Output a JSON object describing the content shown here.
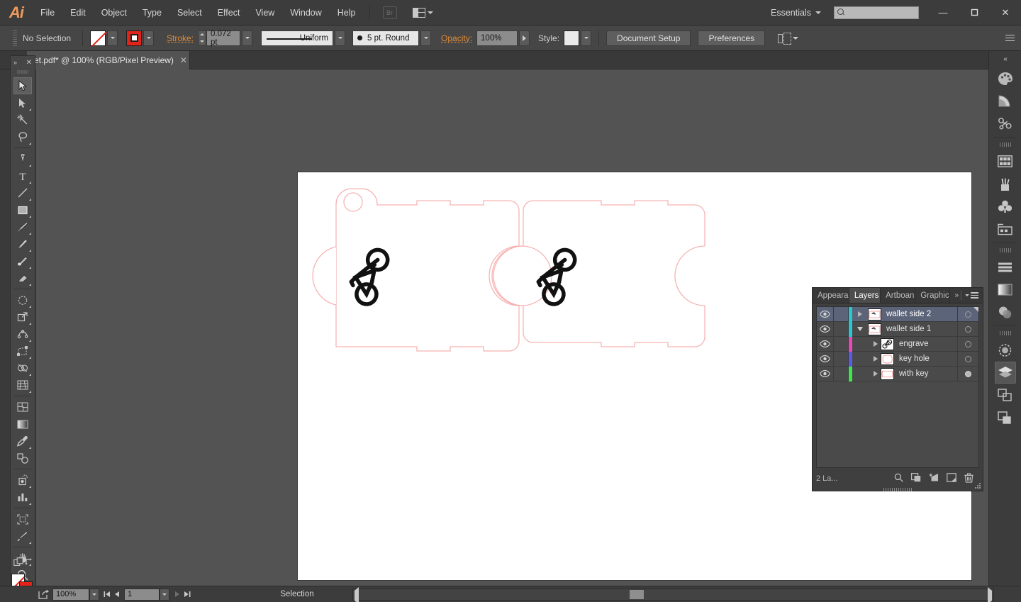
{
  "app": {
    "name": "Adobe Illustrator",
    "logo_text": "Ai"
  },
  "menubar": {
    "items": [
      "File",
      "Edit",
      "Object",
      "Type",
      "Select",
      "Effect",
      "View",
      "Window",
      "Help"
    ],
    "bridge_label": "Br",
    "workspace": "Essentials",
    "search_value": "",
    "window_buttons": {
      "minimize": "—",
      "maximize": "❐",
      "close": "✕"
    }
  },
  "controlbar": {
    "selection_state": "No Selection",
    "fill_label": "Fill",
    "stroke_swatch_label": "Stroke color",
    "stroke_label": "Stroke:",
    "stroke_weight": "0.072 pt",
    "stroke_profile": "Uniform",
    "brush_definition": "5 pt. Round",
    "opacity_label": "Opacity:",
    "opacity_value": "100%",
    "style_label": "Style:",
    "document_setup": "Document Setup",
    "preferences": "Preferences",
    "align_label": "Align to selection"
  },
  "document_tab": {
    "title": "et.pdf* @ 100% (RGB/Pixel Preview)",
    "close": "✕"
  },
  "toolbar": {
    "collapse": "»",
    "close": "✕",
    "tools": [
      {
        "name": "selection-tool",
        "selected": true
      },
      {
        "name": "direct-selection-tool",
        "selected": false
      },
      {
        "name": "magic-wand-tool",
        "selected": false
      },
      {
        "name": "lasso-tool",
        "selected": false
      },
      {
        "name": "pen-tool",
        "selected": false
      },
      {
        "name": "type-tool",
        "selected": false
      },
      {
        "name": "line-segment-tool",
        "selected": false
      },
      {
        "name": "rectangle-tool",
        "selected": false
      },
      {
        "name": "paintbrush-tool",
        "selected": false
      },
      {
        "name": "pencil-tool",
        "selected": false
      },
      {
        "name": "blob-brush-tool",
        "selected": false
      },
      {
        "name": "eraser-tool",
        "selected": false
      },
      {
        "name": "rotate-tool",
        "selected": false
      },
      {
        "name": "scale-tool",
        "selected": false
      },
      {
        "name": "width-tool",
        "selected": false
      },
      {
        "name": "free-transform-tool",
        "selected": false
      },
      {
        "name": "shape-builder-tool",
        "selected": false
      },
      {
        "name": "perspective-grid-tool",
        "selected": false
      },
      {
        "name": "mesh-tool",
        "selected": false
      },
      {
        "name": "gradient-tool",
        "selected": false
      },
      {
        "name": "eyedropper-tool",
        "selected": false
      },
      {
        "name": "blend-tool",
        "selected": false
      },
      {
        "name": "symbol-sprayer-tool",
        "selected": false
      },
      {
        "name": "column-graph-tool",
        "selected": false
      },
      {
        "name": "artboard-tool",
        "selected": false
      },
      {
        "name": "slice-tool",
        "selected": false
      },
      {
        "name": "hand-tool",
        "selected": false
      },
      {
        "name": "zoom-tool",
        "selected": false
      }
    ],
    "fill_state": "none",
    "stroke_state": "red"
  },
  "canvas": {
    "artboard_background": "#ffffff",
    "workspace_background": "#535353",
    "cut_line_color": "#f7b3b3",
    "engrave_color": "#000000",
    "artwork_description": "Two-panel leather wallet die-line with bicycle engravings"
  },
  "right_dock": {
    "collapse": "«",
    "icons": [
      {
        "name": "color-panel-icon"
      },
      {
        "name": "color-guide-panel-icon"
      },
      {
        "name": "symbols-panel-icon"
      },
      {
        "name": "swatches-panel-icon"
      },
      {
        "name": "brushes-panel-icon"
      },
      {
        "name": "graphic-styles-panel-icon"
      },
      {
        "name": "artboards-panel-icon"
      },
      {
        "name": "align-panel-icon"
      },
      {
        "name": "gradient-panel-icon"
      },
      {
        "name": "transparency-panel-icon"
      },
      {
        "name": "appearance-panel-icon"
      },
      {
        "name": "layers-panel-icon",
        "active": true
      },
      {
        "name": "pathfinder-panel-icon"
      },
      {
        "name": "transform-panel-icon"
      }
    ]
  },
  "layers_panel": {
    "tabs": [
      {
        "label": "Appeara",
        "active": false
      },
      {
        "label": "Layers",
        "active": true
      },
      {
        "label": "Artboan",
        "active": false
      },
      {
        "label": "Graphic",
        "active": false
      }
    ],
    "rows": [
      {
        "name": "wallet side 2",
        "color": "#28c8d2",
        "expanded": false,
        "indent": 0,
        "selected": true,
        "targeted": false,
        "visible": true,
        "thumb": "wallet-outline"
      },
      {
        "name": "wallet side 1",
        "color": "#28c8d2",
        "expanded": true,
        "indent": 0,
        "selected": false,
        "targeted": false,
        "visible": true,
        "thumb": "wallet-outline"
      },
      {
        "name": "engrave",
        "color": "#e849b6",
        "expanded": false,
        "indent": 1,
        "selected": false,
        "targeted": false,
        "visible": true,
        "thumb": "bicycle"
      },
      {
        "name": "key hole",
        "color": "#5b5be8",
        "expanded": false,
        "indent": 1,
        "selected": false,
        "targeted": false,
        "visible": true,
        "thumb": "keyhole"
      },
      {
        "name": "with key",
        "color": "#3ce84a",
        "expanded": false,
        "indent": 1,
        "selected": false,
        "targeted": true,
        "visible": true,
        "thumb": "wallet-key"
      }
    ],
    "footer_count": "2 La...",
    "footer_icons": [
      {
        "name": "locate-object-icon"
      },
      {
        "name": "make-clipping-mask-icon"
      },
      {
        "name": "create-new-sublayer-icon"
      },
      {
        "name": "create-new-layer-icon"
      },
      {
        "name": "delete-selection-icon"
      }
    ]
  },
  "statusbar": {
    "zoom_level": "100%",
    "page_number": "1",
    "status_text": "Selection",
    "first_label": "First artboard",
    "prev_label": "Previous artboard",
    "next_label": "Next artboard",
    "last_label": "Last artboard"
  }
}
